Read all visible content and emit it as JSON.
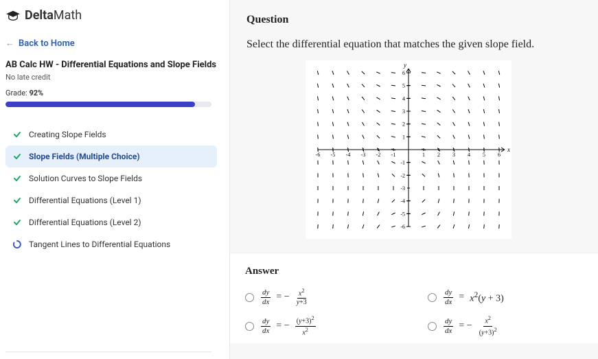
{
  "brand": {
    "prefix": "Delta",
    "suffix": "Math"
  },
  "nav": {
    "back": "Back to Home"
  },
  "assignment": {
    "title": "AB Calc HW - Differential Equations and Slope Fields",
    "credit_note": "No late credit",
    "grade_label": "Grade:",
    "grade_value": "92%",
    "progress_pct": 92
  },
  "topics": [
    {
      "label": "Creating Slope Fields",
      "status": "done"
    },
    {
      "label": "Slope Fields (Multiple Choice)",
      "status": "done",
      "active": true
    },
    {
      "label": "Solution Curves to Slope Fields",
      "status": "done"
    },
    {
      "label": "Differential Equations (Level 1)",
      "status": "done"
    },
    {
      "label": "Differential Equations (Level 2)",
      "status": "done"
    },
    {
      "label": "Tangent Lines to Differential Equations",
      "status": "pending"
    }
  ],
  "question": {
    "heading": "Question",
    "prompt": "Select the differential equation that matches the given slope field."
  },
  "slope_field": {
    "x_range": [
      -6,
      6
    ],
    "y_range": [
      -6,
      6
    ],
    "x_axis_label": "x",
    "y_axis_label": "y",
    "equation": "dy/dx = -x^2/(y+3)"
  },
  "answer": {
    "heading": "Answer",
    "choices": [
      {
        "id": "A",
        "latex": "dy/dx = -x^2/(y+3)"
      },
      {
        "id": "B",
        "latex": "dy/dx = x^2(y+3)"
      },
      {
        "id": "C",
        "latex": "dy/dx = -(y+3)^2/x^2"
      },
      {
        "id": "D",
        "latex": "dy/dx = -x^2/(y+3)^2"
      }
    ]
  }
}
